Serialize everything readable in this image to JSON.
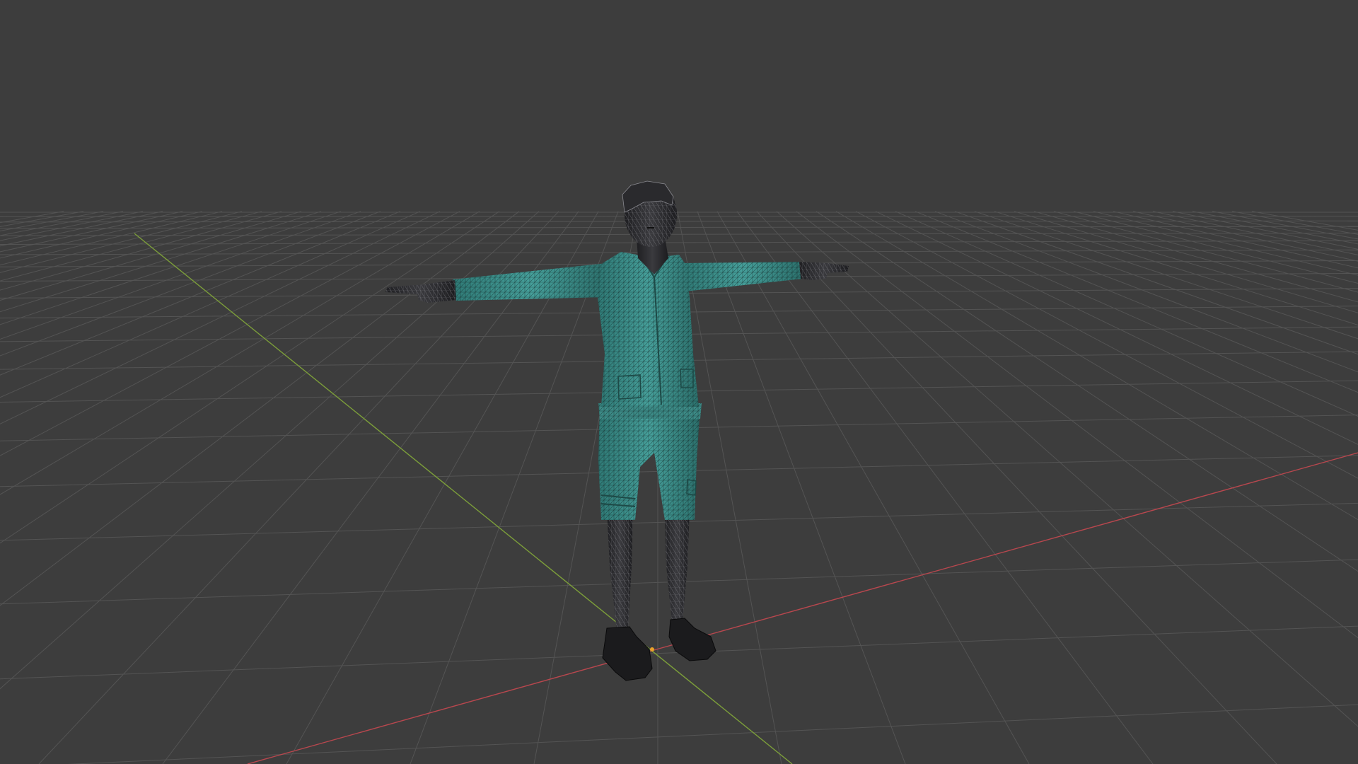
{
  "viewport": {
    "background_color": "#3d3d3d",
    "grid_line_color": "#545454",
    "x_axis_color": "#b8474e",
    "y_axis_color": "#7c9e3a",
    "origin_marker_color": "#e8a12a",
    "shading_mode": "wireframe-overlay-on-solid",
    "floor_grid": true,
    "show_axes": [
      "x",
      "y"
    ]
  },
  "model": {
    "pose": "t-pose",
    "outfit_color": "#3f8f8b",
    "skin_color": "#2b2b2e",
    "shoe_color": "#1b1b1d",
    "wire_color": "#0f1a1a"
  }
}
